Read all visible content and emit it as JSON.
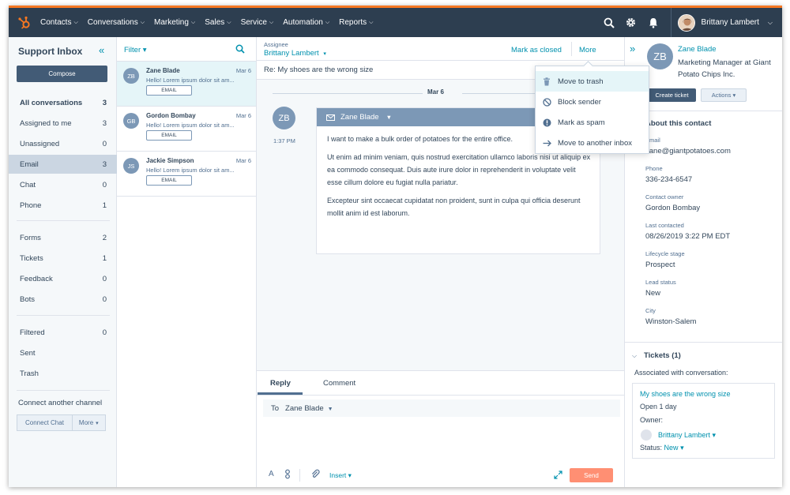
{
  "nav": {
    "items": [
      {
        "label": "Contacts"
      },
      {
        "label": "Conversations"
      },
      {
        "label": "Marketing"
      },
      {
        "label": "Sales"
      },
      {
        "label": "Service"
      },
      {
        "label": "Automation"
      },
      {
        "label": "Reports"
      }
    ],
    "user_name": "Brittany Lambert"
  },
  "sidebar": {
    "title": "Support Inbox",
    "compose_label": "Compose",
    "items": [
      {
        "label": "All conversations",
        "count": "3"
      },
      {
        "label": "Assigned to me",
        "count": "3"
      },
      {
        "label": "Unassigned",
        "count": "0"
      },
      {
        "label": "Email",
        "count": "3"
      },
      {
        "label": "Chat",
        "count": "0"
      },
      {
        "label": "Phone",
        "count": "1"
      },
      {
        "label": "Forms",
        "count": "2"
      },
      {
        "label": "Tickets",
        "count": "1"
      },
      {
        "label": "Feedback",
        "count": "0"
      },
      {
        "label": "Bots",
        "count": "0"
      },
      {
        "label": "Filtered",
        "count": "0"
      },
      {
        "label": "Sent",
        "count": ""
      },
      {
        "label": "Trash",
        "count": ""
      }
    ],
    "connect_label": "Connect another channel",
    "connect_chat_label": "Connect Chat",
    "more_label": "More"
  },
  "convlist": {
    "filter_label": "Filter",
    "conversations": [
      {
        "initials": "ZB",
        "name": "Zane Blade",
        "date": "Mar 6",
        "snippet": "Hello! Lorem ipsum dolor sit am...",
        "tag": "EMAIL"
      },
      {
        "initials": "GB",
        "name": "Gordon Bombay",
        "date": "Mar 6",
        "snippet": "Hello! Lorem ipsum dolor sit am...",
        "tag": "EMAIL"
      },
      {
        "initials": "JS",
        "name": "Jackie Simpson",
        "date": "Mar 6",
        "snippet": "Hello! Lorem ipsum dolor sit am...",
        "tag": "EMAIL"
      }
    ]
  },
  "thread": {
    "assignee_label": "Assignee",
    "assignee_value": "Brittany Lambert",
    "mark_closed_label": "Mark as closed",
    "more_label": "More",
    "subject": "Re: My shoes are the wrong size",
    "date_divider": "Mar 6",
    "sender_initials": "ZB",
    "sender_name": "Zane Blade",
    "time": "1:37 PM",
    "paragraphs": [
      "I want to make a bulk order of potatoes for the entire office.",
      "Ut enim ad minim veniam, quis nostrud exercitation ullamco laboris nisi ut aliquip ex ea commodo consequat. Duis aute irure dolor in reprehenderit in voluptate velit esse cillum dolore eu fugiat nulla pariatur.",
      "Excepteur sint occaecat cupidatat non proident, sunt in culpa qui officia deserunt mollit anim id est laborum."
    ]
  },
  "reply": {
    "tab_reply": "Reply",
    "tab_comment": "Comment",
    "to_label": "To",
    "to_value": "Zane Blade",
    "format_label": "A",
    "insert_label": "Insert",
    "send_label": "Send"
  },
  "dropdown": {
    "items": [
      {
        "label": "Move to trash",
        "icon": "trash-icon"
      },
      {
        "label": "Block sender",
        "icon": "block-icon"
      },
      {
        "label": "Mark as spam",
        "icon": "spam-icon"
      },
      {
        "label": "Move to another inbox",
        "icon": "arrow-right-icon"
      }
    ]
  },
  "contact": {
    "initials": "ZB",
    "name": "Zane Blade",
    "title": "Marketing Manager at Giant Potato Chips Inc.",
    "create_ticket_label": "Create ticket",
    "actions_label": "Actions",
    "section_title": "About this contact",
    "fields": [
      {
        "label": "Email",
        "value": "zane@giantpotatoes.com"
      },
      {
        "label": "Phone",
        "value": "336-234-6547"
      },
      {
        "label": "Contact owner",
        "value": "Gordon Bombay"
      },
      {
        "label": "Last contacted",
        "value": "08/26/2019 3:22 PM EDT"
      },
      {
        "label": "Lifecycle stage",
        "value": "Prospect"
      },
      {
        "label": "Lead status",
        "value": "New"
      },
      {
        "label": "City",
        "value": "Winston-Salem"
      }
    ]
  },
  "tickets": {
    "title": "Tickets (1)",
    "associated_label": "Associated with conversation:",
    "ticket_name": "My shoes are the wrong size",
    "open_for": "Open 1 day",
    "owner_label": "Owner:",
    "owner_name": "Brittany Lambert",
    "status_label": "Status:",
    "status_value": "New"
  },
  "colors": {
    "nav_bg": "#2d3e50",
    "accent_orange": "#f57722",
    "link_teal": "#0091ae",
    "send_button": "#ff8f73",
    "avatar_gray": "#7c98b6"
  }
}
